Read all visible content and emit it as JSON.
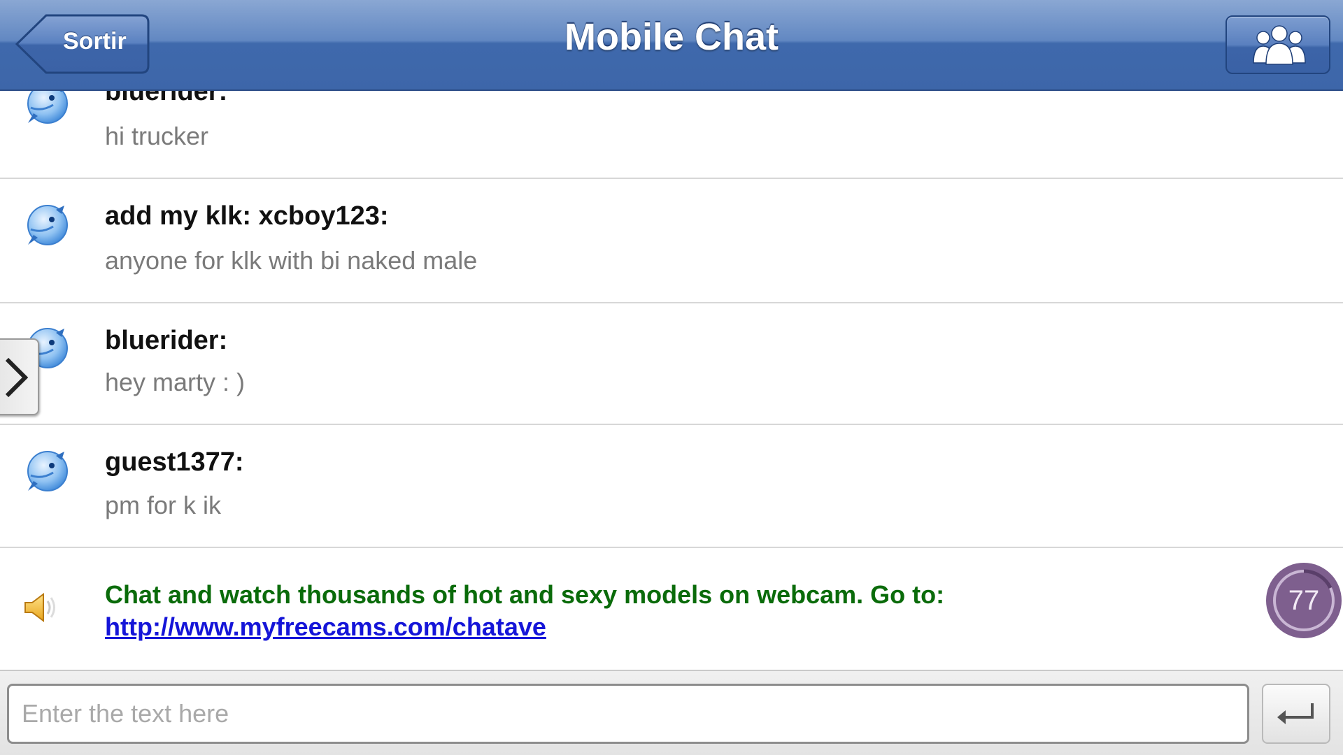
{
  "header": {
    "title": "Mobile Chat",
    "back_label": "Sortir",
    "users_icon": "users-group-icon"
  },
  "messages": [
    {
      "name": "bluerider:",
      "text": "hi trucker",
      "avatar_icon": "bird-avatar-icon"
    },
    {
      "name": "add my klk: xcboy123:",
      "text": "anyone for klk with bi naked male",
      "avatar_icon": "bird-avatar-icon"
    },
    {
      "name": "bluerider:",
      "text": "hey marty : )",
      "avatar_icon": "bird-avatar-icon"
    },
    {
      "name": "guest1377:",
      "text": "pm for k ik",
      "avatar_icon": "bird-avatar-icon"
    }
  ],
  "promo": {
    "text": "Chat and watch thousands of hot and sexy models on webcam. Go to:",
    "link": "http://www.myfreecams.com/chatave",
    "icon": "speaker-icon",
    "text_color": "#0a6b0a",
    "link_color": "#1515d8"
  },
  "counter": {
    "value": "77"
  },
  "drawer": {
    "icon": "chevron-right-icon"
  },
  "input": {
    "value": "",
    "placeholder": "Enter the text here"
  },
  "send": {
    "icon": "enter-return-icon"
  },
  "colors": {
    "header_blue": "#3d66a9",
    "counter_purple": "#7e5f8e"
  }
}
